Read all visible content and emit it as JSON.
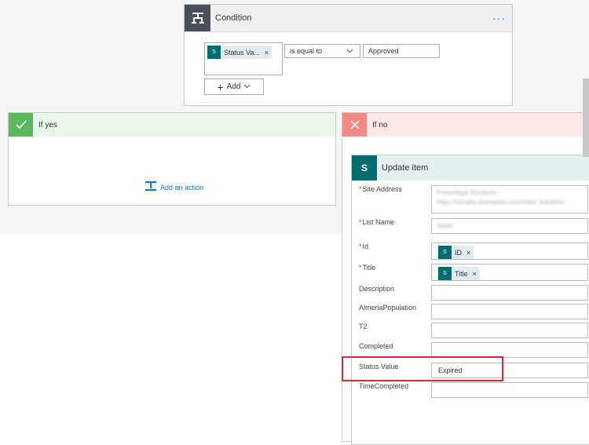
{
  "condition": {
    "title": "Condition",
    "menu": "···",
    "token_label": "Status Va...",
    "token_remove": "×",
    "operator": "is equal to",
    "value": "Approved",
    "add_label": "Add"
  },
  "if_yes": {
    "title": "If yes",
    "add_action": "Add an action"
  },
  "if_no": {
    "title": "If no"
  },
  "update_item": {
    "title": "Update item",
    "fields": [
      {
        "label": "Site Address",
        "required": "*",
        "value": "PowerApps Solutions - https://sample.sharepoint.com/sites/ Solutions"
      },
      {
        "label": "List Name",
        "required": "*",
        "value": "Spain"
      },
      {
        "label": "Id",
        "required": "*",
        "token": "ID",
        "remove": "×"
      },
      {
        "label": "Title",
        "required": "*",
        "token": "Title",
        "remove": "×"
      },
      {
        "label": "Description",
        "value": ""
      },
      {
        "label": "AlmeriaPopulation",
        "value": ""
      },
      {
        "label": "T2",
        "value": ""
      },
      {
        "label": "Completed",
        "value": ""
      },
      {
        "label": "Status Value",
        "value": "Expired"
      },
      {
        "label": "TimeCompleted",
        "value": ""
      }
    ]
  },
  "colors": {
    "accent": "#0078d4",
    "sharepoint": "#036c70",
    "yes_green": "#5cb85c",
    "no_red": "#f08a83",
    "highlight": "#d9272e"
  }
}
